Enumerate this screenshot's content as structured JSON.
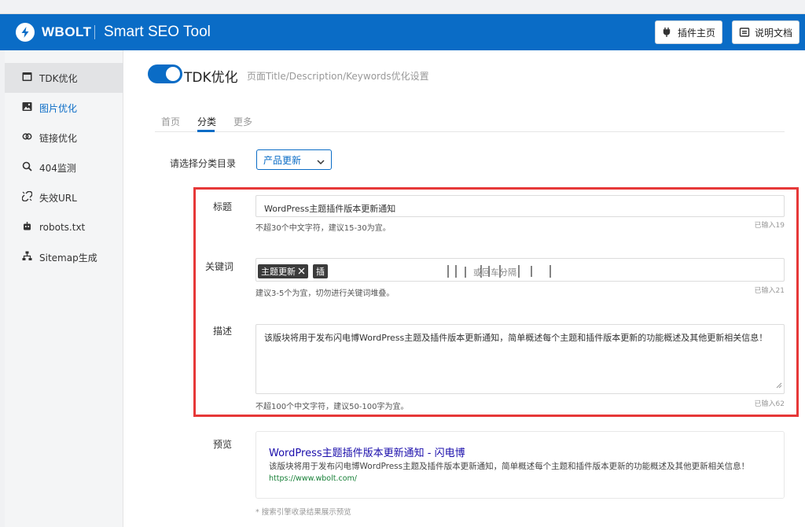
{
  "header": {
    "brand": "WBOLT",
    "app_name": "Smart SEO Tool",
    "buttons": [
      {
        "label": "插件主页",
        "icon": "plug-icon"
      },
      {
        "label": "说明文档",
        "icon": "book-icon"
      }
    ]
  },
  "sidebar": {
    "items": [
      {
        "label": "TDK优化",
        "icon": "window-icon",
        "state": "active"
      },
      {
        "label": "图片优化",
        "icon": "image-icon",
        "state": "highlighted"
      },
      {
        "label": "链接优化",
        "icon": "link-icon"
      },
      {
        "label": "404监测",
        "icon": "search-icon"
      },
      {
        "label": "失效URL",
        "icon": "broken-link-icon"
      },
      {
        "label": "robots.txt",
        "icon": "robot-icon"
      },
      {
        "label": "Sitemap生成",
        "icon": "sitemap-icon"
      }
    ]
  },
  "main": {
    "section_title": "TDK优化",
    "section_subtitle": "页面Title/Description/Keywords优化设置",
    "toggle_on": true,
    "tabs": [
      {
        "label": "首页"
      },
      {
        "label": "分类",
        "active": true
      },
      {
        "label": "更多"
      }
    ],
    "category": {
      "label": "请选择分类目录",
      "selected": "产品更新"
    },
    "title_field": {
      "label": "标题",
      "value": "WordPress主题插件版本更新通知",
      "hint": "不超30个中文字符，建议15-30为宜。",
      "count": "已输入19"
    },
    "keywords_field": {
      "label": "关键词",
      "tags": [
        "主题更新",
        "插"
      ],
      "placeholder_tail": "或回车分隔",
      "hint": "建议3-5个为宜，切勿进行关键词堆叠。",
      "count": "已输入21"
    },
    "description_field": {
      "label": "描述",
      "value": "该版块将用于发布闪电博WordPress主题及插件版本更新通知，简单概述每个主题和插件版本更新的功能概述及其他更新相关信息！",
      "hint": "不超100个中文字符，建议50-100字为宜。",
      "count": "已输入62"
    },
    "preview": {
      "label": "预览",
      "title": "WordPress主题插件版本更新通知 - 闪电博",
      "description": "该版块将用于发布闪电博WordPress主题及插件版本更新通知，简单概述每个主题和插件版本更新的功能概述及其他更新相关信息！",
      "url": "https://www.wbolt.com/",
      "note": "* 搜索引擎收录结果展示预览"
    }
  },
  "colors": {
    "brand_blue": "#0a6cc6",
    "highlight_red": "#e63838",
    "link_blue": "#1a0dab",
    "url_green": "#188038"
  }
}
